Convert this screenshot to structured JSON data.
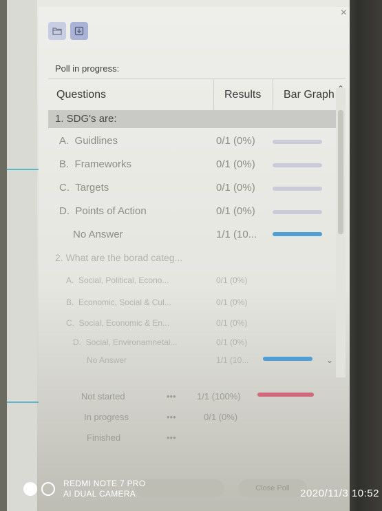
{
  "toolbar": {
    "icons": [
      "folder-icon",
      "download-icon"
    ]
  },
  "poll": {
    "status": "Poll in progress:"
  },
  "table": {
    "headers": {
      "questions": "Questions",
      "results": "Results",
      "bar_graph": "Bar Graph"
    },
    "questions": [
      {
        "label": "1. SDG's are:",
        "options": [
          {
            "letter": "A.",
            "text": "Guidlines",
            "result": "0/1 (0%)",
            "fraction": 0
          },
          {
            "letter": "B.",
            "text": "Frameworks",
            "result": "0/1 (0%)",
            "fraction": 0
          },
          {
            "letter": "C.",
            "text": "Targets",
            "result": "0/1 (0%)",
            "fraction": 0
          },
          {
            "letter": "D.",
            "text": "Points of Action",
            "result": "0/1 (0%)",
            "fraction": 0
          },
          {
            "letter": "",
            "text": "No Answer",
            "result": "1/1 (10...",
            "fraction": 1
          }
        ]
      },
      {
        "label": "2. What are the borad categ...",
        "options": [
          {
            "letter": "A.",
            "text": "Social, Political, Econo...",
            "result": "0/1 (0%)",
            "fraction": 0
          },
          {
            "letter": "B.",
            "text": "Economic, Social & Cul...",
            "result": "0/1 (0%)",
            "fraction": 0
          },
          {
            "letter": "C.",
            "text": "Social, Economic & En...",
            "result": "0/1 (0%)",
            "fraction": 0
          },
          {
            "letter": "D.",
            "text": "Social, Environamnetal...",
            "result": "0/1 (0%)",
            "fraction": 0
          },
          {
            "letter": "",
            "text": "No Answer",
            "result": "1/1 (10...",
            "fraction": 1
          }
        ]
      }
    ]
  },
  "attendee_status": [
    {
      "label": "Not started",
      "dots": "•••",
      "result": "1/1 (100%)",
      "fraction": 1
    },
    {
      "label": "In progress",
      "dots": "•••",
      "result": "0/1 (0%)",
      "fraction": 0
    },
    {
      "label": "Finished",
      "dots": "•••",
      "result": "",
      "fraction": 0
    }
  ],
  "buttons": {
    "close_poll": "Close Poll"
  },
  "colors": {
    "bar_fill_blue": "#4f9fd4",
    "bar_fill_red": "#d06a7a",
    "bar_track": "#c9ccd8",
    "selected_row": "#c9cac5"
  },
  "photo_overlay": {
    "device": "REDMI NOTE 7 PRO",
    "camera": "AI DUAL CAMERA",
    "timestamp": "2020/11/3 10:52"
  }
}
